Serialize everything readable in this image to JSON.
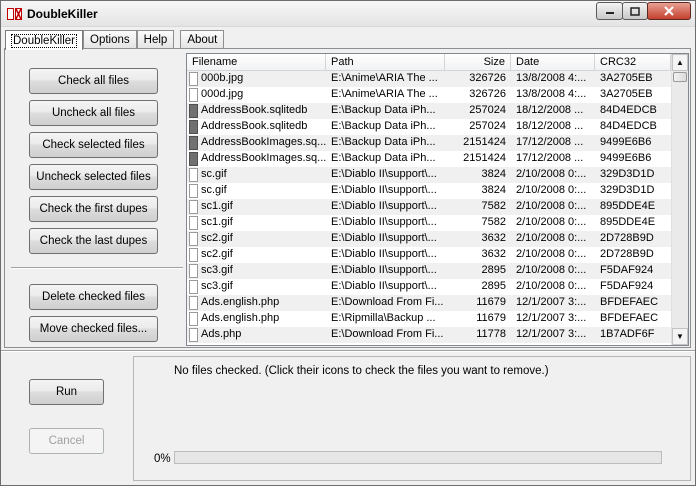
{
  "window": {
    "title": "DoubleKiller",
    "icon": "app-icon"
  },
  "tabs": [
    "DoubleKiller",
    "Options",
    "Help",
    "About"
  ],
  "actions": {
    "check_all": "Check all files",
    "uncheck_all": "Uncheck all files",
    "check_selected": "Check selected files",
    "uncheck_selected": "Uncheck selected files",
    "check_first": "Check the first dupes",
    "check_last": "Check the last dupes",
    "delete_checked": "Delete checked files",
    "move_checked": "Move checked files..."
  },
  "list": {
    "columns": [
      "Filename",
      "Path",
      "Size",
      "Date",
      "CRC32"
    ],
    "rows": [
      {
        "icon": "file-icon",
        "filename": "000b.jpg",
        "path": "E:\\Anime\\ARIA The ...",
        "size": "326726",
        "date": "13/8/2008 4:...",
        "crc": "3A2705EB"
      },
      {
        "icon": "file-icon",
        "filename": "000d.jpg",
        "path": "E:\\Anime\\ARIA The ...",
        "size": "326726",
        "date": "13/8/2008 4:...",
        "crc": "3A2705EB"
      },
      {
        "icon": "dark-file-icon",
        "filename": "AddressBook.sqlitedb",
        "path": "E:\\Backup Data iPh...",
        "size": "257024",
        "date": "18/12/2008 ...",
        "crc": "84D4EDCB"
      },
      {
        "icon": "dark-file-icon",
        "filename": "AddressBook.sqlitedb",
        "path": "E:\\Backup Data iPh...",
        "size": "257024",
        "date": "18/12/2008 ...",
        "crc": "84D4EDCB"
      },
      {
        "icon": "dark-file-icon",
        "filename": "AddressBookImages.sq...",
        "path": "E:\\Backup Data iPh...",
        "size": "2151424",
        "date": "17/12/2008 ...",
        "crc": "9499E6B6"
      },
      {
        "icon": "dark-file-icon",
        "filename": "AddressBookImages.sq...",
        "path": "E:\\Backup Data iPh...",
        "size": "2151424",
        "date": "17/12/2008 ...",
        "crc": "9499E6B6"
      },
      {
        "icon": "file-icon",
        "filename": "sc.gif",
        "path": "E:\\Diablo II\\support\\...",
        "size": "3824",
        "date": "2/10/2008 0:...",
        "crc": "329D3D1D"
      },
      {
        "icon": "file-icon",
        "filename": "sc.gif",
        "path": "E:\\Diablo II\\support\\...",
        "size": "3824",
        "date": "2/10/2008 0:...",
        "crc": "329D3D1D"
      },
      {
        "icon": "file-icon",
        "filename": "sc1.gif",
        "path": "E:\\Diablo II\\support\\...",
        "size": "7582",
        "date": "2/10/2008 0:...",
        "crc": "895DDE4E"
      },
      {
        "icon": "file-icon",
        "filename": "sc1.gif",
        "path": "E:\\Diablo II\\support\\...",
        "size": "7582",
        "date": "2/10/2008 0:...",
        "crc": "895DDE4E"
      },
      {
        "icon": "file-icon",
        "filename": "sc2.gif",
        "path": "E:\\Diablo II\\support\\...",
        "size": "3632",
        "date": "2/10/2008 0:...",
        "crc": "2D728B9D"
      },
      {
        "icon": "file-icon",
        "filename": "sc2.gif",
        "path": "E:\\Diablo II\\support\\...",
        "size": "3632",
        "date": "2/10/2008 0:...",
        "crc": "2D728B9D"
      },
      {
        "icon": "file-icon",
        "filename": "sc3.gif",
        "path": "E:\\Diablo II\\support\\...",
        "size": "2895",
        "date": "2/10/2008 0:...",
        "crc": "F5DAF924"
      },
      {
        "icon": "file-icon",
        "filename": "sc3.gif",
        "path": "E:\\Diablo II\\support\\...",
        "size": "2895",
        "date": "2/10/2008 0:...",
        "crc": "F5DAF924"
      },
      {
        "icon": "file-icon",
        "filename": "Ads.english.php",
        "path": "E:\\Download From Fi...",
        "size": "11679",
        "date": "12/1/2007 3:...",
        "crc": "BFDEFAEC"
      },
      {
        "icon": "file-icon",
        "filename": "Ads.english.php",
        "path": "E:\\Ripmilla\\Backup ...",
        "size": "11679",
        "date": "12/1/2007 3:...",
        "crc": "BFDEFAEC"
      },
      {
        "icon": "file-icon",
        "filename": "Ads.php",
        "path": "E:\\Download From Fi...",
        "size": "11778",
        "date": "12/1/2007 3:...",
        "crc": "1B7ADF6F"
      }
    ]
  },
  "run": {
    "run_label": "Run",
    "cancel_label": "Cancel"
  },
  "status": {
    "message": "No files checked. (Click their icons to check the files you want to remove.)",
    "progress_text": "0%",
    "progress_fraction": 0
  }
}
